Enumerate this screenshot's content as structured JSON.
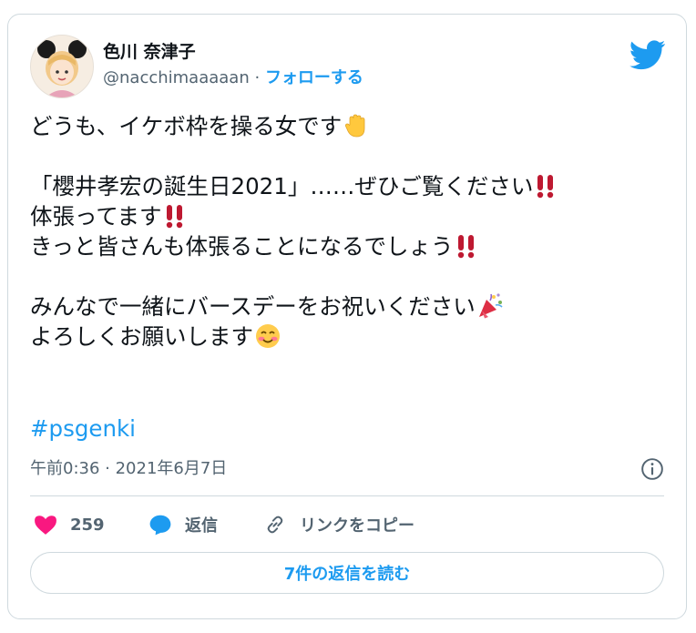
{
  "author": {
    "display_name": "色川 奈津子",
    "handle": "@nacchimaaaaan",
    "separator": "·",
    "follow_label": "フォローする"
  },
  "body": {
    "lines": [
      "どうも、イケボ枠を操る女です",
      "",
      "「櫻井孝宏の誕生日2021」……ぜひご覧ください",
      "体張ってます",
      "きっと皆さんも体張ることになるでしょう",
      "",
      "みんなで一緒にバースデーをお祝いください",
      "よろしくお願いします"
    ],
    "hashtag": "#psgenki"
  },
  "meta": {
    "timestamp": "午前0:36 · 2021年6月7日"
  },
  "actions": {
    "like_count": "259",
    "reply_label": "返信",
    "copy_link_label": "リンクをコピー"
  },
  "footer": {
    "read_replies_label": "7件の返信を読む"
  },
  "icons": {
    "brand": "twitter-bird-icon",
    "info": "info-icon",
    "like": "heart-icon",
    "reply": "speech-bubble-icon",
    "copy": "link-icon",
    "emoji_1": "raised-hand-emoji",
    "emoji_2": "double-exclamation-emoji",
    "emoji_3": "party-popper-emoji",
    "emoji_4": "smiling-face-emoji"
  },
  "colors": {
    "accent": "#1d9bf0",
    "like": "#f91880",
    "text": "#0f1419",
    "muted": "#536471",
    "border": "#cfd9de"
  }
}
